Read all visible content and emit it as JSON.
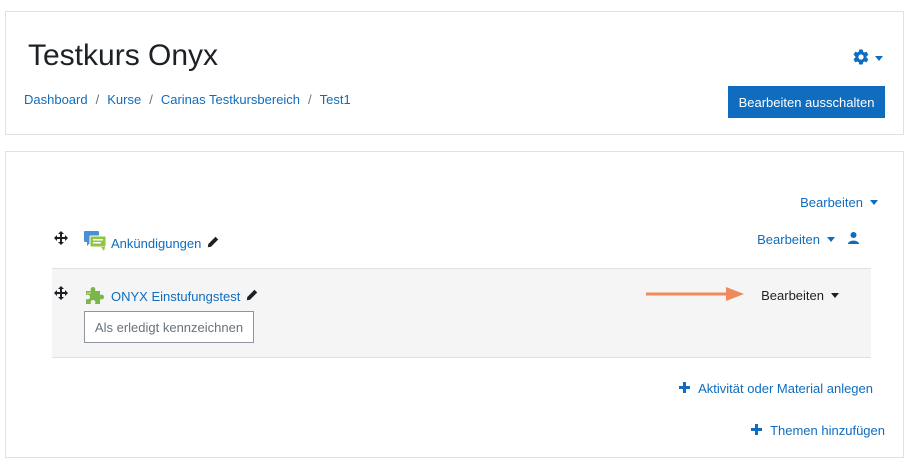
{
  "header": {
    "title": "Testkurs Onyx",
    "breadcrumb": [
      {
        "label": "Dashboard"
      },
      {
        "label": "Kurse"
      },
      {
        "label": "Carinas Testkursbereich"
      },
      {
        "label": "Test1"
      }
    ],
    "breadcrumb_separator": "/",
    "edit_toggle_label": "Bearbeiten ausschalten",
    "gear_icon": "gear-icon"
  },
  "section": {
    "edit_label": "Bearbeiten",
    "activities": [
      {
        "name": "Ankündigungen",
        "icon": "forum-icon",
        "edit_label": "Bearbeiten"
      },
      {
        "name": "ONYX Einstufungstest",
        "icon": "puzzle-icon",
        "edit_label": "Bearbeiten",
        "completion_label": "Als erledigt kennzeichnen"
      }
    ],
    "add_activity_label": "Aktivität oder Material anlegen",
    "add_topics_label": "Themen hinzufügen"
  },
  "colors": {
    "link": "#0f6cbf",
    "primary_button": "#0f6cbf",
    "highlight_row": "#f5f5f5",
    "annotation_arrow": "#f08a5d",
    "forum_icon": "#4a90d9",
    "puzzle_icon": "#7ab648"
  }
}
